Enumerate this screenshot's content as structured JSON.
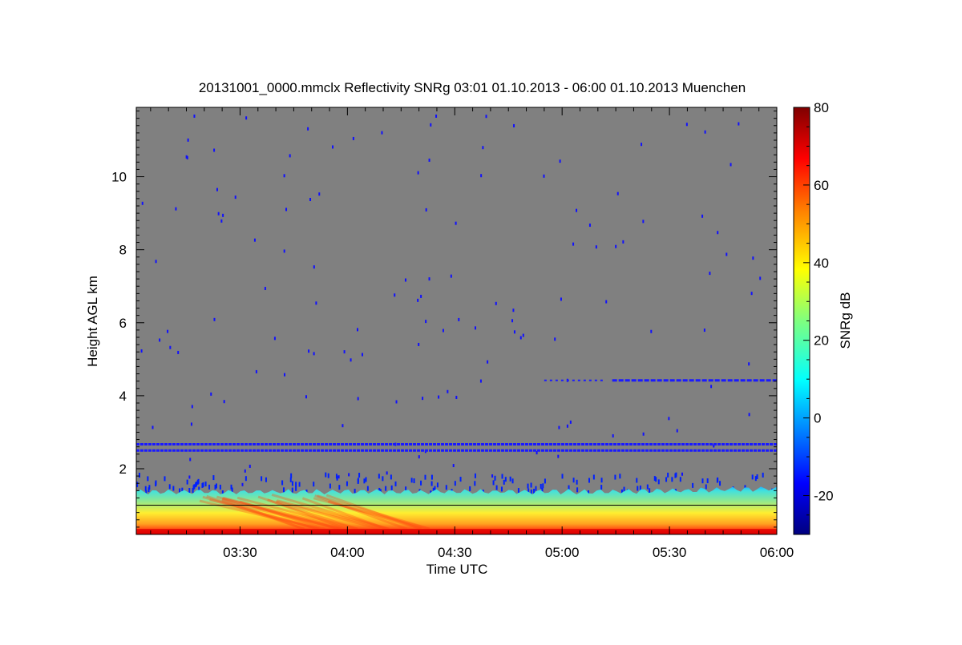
{
  "chart_data": {
    "type": "heatmap",
    "title": "20131001_0000.mmclx Reflectivity SNRg   03:01 01.10.2013 - 06:00 01.10.2013 Muenchen",
    "xlabel": "Time UTC",
    "ylabel": "Height AGL km",
    "xlim": [
      "03:01",
      "06:00"
    ],
    "ylim": [
      0.2,
      11.9
    ],
    "x_ticks": [
      "03:30",
      "04:00",
      "04:30",
      "05:00",
      "05:30",
      "06:00"
    ],
    "y_ticks": [
      2,
      4,
      6,
      8,
      10
    ],
    "background_color": "#808080",
    "colorbar": {
      "label": "SNRg dB",
      "range": [
        -30,
        80
      ],
      "ticks": [
        -20,
        0,
        20,
        40,
        60,
        80
      ],
      "colors": [
        "#00007f",
        "#0000ff",
        "#00ffff",
        "#7fff7f",
        "#ffff00",
        "#ff7f00",
        "#ff0000",
        "#7f0000"
      ]
    },
    "features": [
      {
        "name": "surface echo layer",
        "from_height_km": 0.2,
        "to_height_km": 1.4,
        "snr_db": [
          20,
          70
        ]
      },
      {
        "name": "horizontal line",
        "height_km": 1.0
      },
      {
        "name": "interference line upper",
        "height_km": 2.67
      },
      {
        "name": "interference line lower",
        "height_km": 2.5
      },
      {
        "name": "noise line",
        "from_time": "05:14",
        "to_time": "06:00",
        "height_km": 4.42
      }
    ]
  }
}
